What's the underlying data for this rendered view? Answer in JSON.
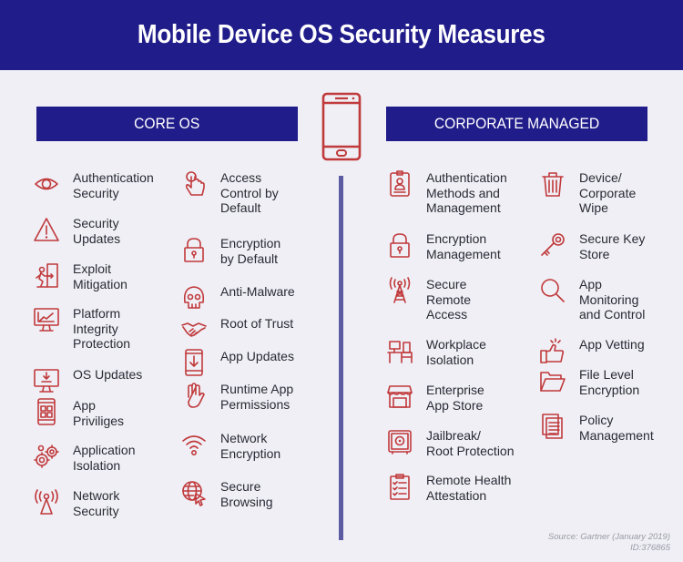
{
  "title": "Mobile Device OS Security Measures",
  "sections": {
    "core_os": {
      "header": "CORE OS",
      "column1": [
        {
          "label": "Authentication\nSecurity",
          "icon": "eye-icon"
        },
        {
          "label": "Security\nUpdates",
          "icon": "warning-icon"
        },
        {
          "label": "Exploit\nMitigation",
          "icon": "exit-door-icon"
        },
        {
          "label": "Platform\nIntegrity\nProtection",
          "icon": "monitor-chart-icon"
        },
        {
          "label": "OS Updates",
          "icon": "monitor-download-icon"
        },
        {
          "label": "App\nPriviliges",
          "icon": "phone-apps-icon"
        },
        {
          "label": "Application\nIsolation",
          "icon": "gears-icon"
        },
        {
          "label": "Network\nSecurity",
          "icon": "antenna-icon"
        }
      ],
      "column2": [
        {
          "label": "Access\nControl by\nDefault",
          "icon": "touch-hand-icon"
        },
        {
          "label": "Encryption\nby Default",
          "icon": "padlock-icon"
        },
        {
          "label": "Anti-Malware",
          "icon": "skull-icon"
        },
        {
          "label": "Root of Trust",
          "icon": "handshake-icon"
        },
        {
          "label": "App Updates",
          "icon": "phone-download-icon"
        },
        {
          "label": "Runtime App\nPermissions",
          "icon": "stop-hand-icon"
        },
        {
          "label": "Network\nEncryption",
          "icon": "wifi-icon"
        },
        {
          "label": "Secure\nBrowsing",
          "icon": "globe-cursor-icon"
        }
      ]
    },
    "corporate_managed": {
      "header": "CORPORATE MANAGED",
      "column1": [
        {
          "label": "Authentication\nMethods and\nManagement",
          "icon": "id-badge-icon"
        },
        {
          "label": "Encryption\nManagement",
          "icon": "padlock-icon"
        },
        {
          "label": "Secure\nRemote\nAccess",
          "icon": "radio-tower-icon"
        },
        {
          "label": "Workplace\nIsolation",
          "icon": "desk-icon"
        },
        {
          "label": "Enterprise\nApp Store",
          "icon": "storefront-icon"
        },
        {
          "label": "Jailbreak/\nRoot Protection",
          "icon": "safe-icon"
        },
        {
          "label": "Remote Health\nAttestation",
          "icon": "checklist-icon"
        }
      ],
      "column2": [
        {
          "label": "Device/\nCorporate\nWipe",
          "icon": "trash-icon"
        },
        {
          "label": "Secure Key\nStore",
          "icon": "key-icon"
        },
        {
          "label": "App\nMonitoring\nand Control",
          "icon": "magnifier-icon"
        },
        {
          "label": "App Vetting",
          "icon": "thumbs-up-icon"
        },
        {
          "label": "File Level\nEncryption",
          "icon": "folder-icon"
        },
        {
          "label": "Policy\nManagement",
          "icon": "document-icon"
        }
      ]
    }
  },
  "center_icon": "smartphone-icon",
  "source": {
    "line1": "Source: Gartner (January 2019)",
    "line2": "ID:376865"
  },
  "colors": {
    "banner": "#201c8a",
    "accent_icon": "#c0393b",
    "divider": "#5c5aa0",
    "background": "#efeff5"
  }
}
